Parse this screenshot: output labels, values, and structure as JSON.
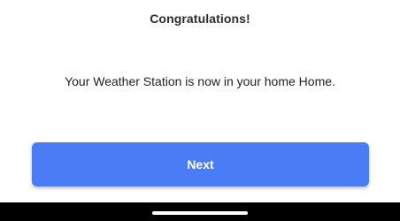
{
  "screen": {
    "title": "Congratulations!",
    "message": "Your Weather Station is now in your home Home.",
    "next_label": "Next"
  },
  "colors": {
    "accent": "#4a7cf5",
    "background": "#ffffff",
    "system_bar": "#000000"
  }
}
